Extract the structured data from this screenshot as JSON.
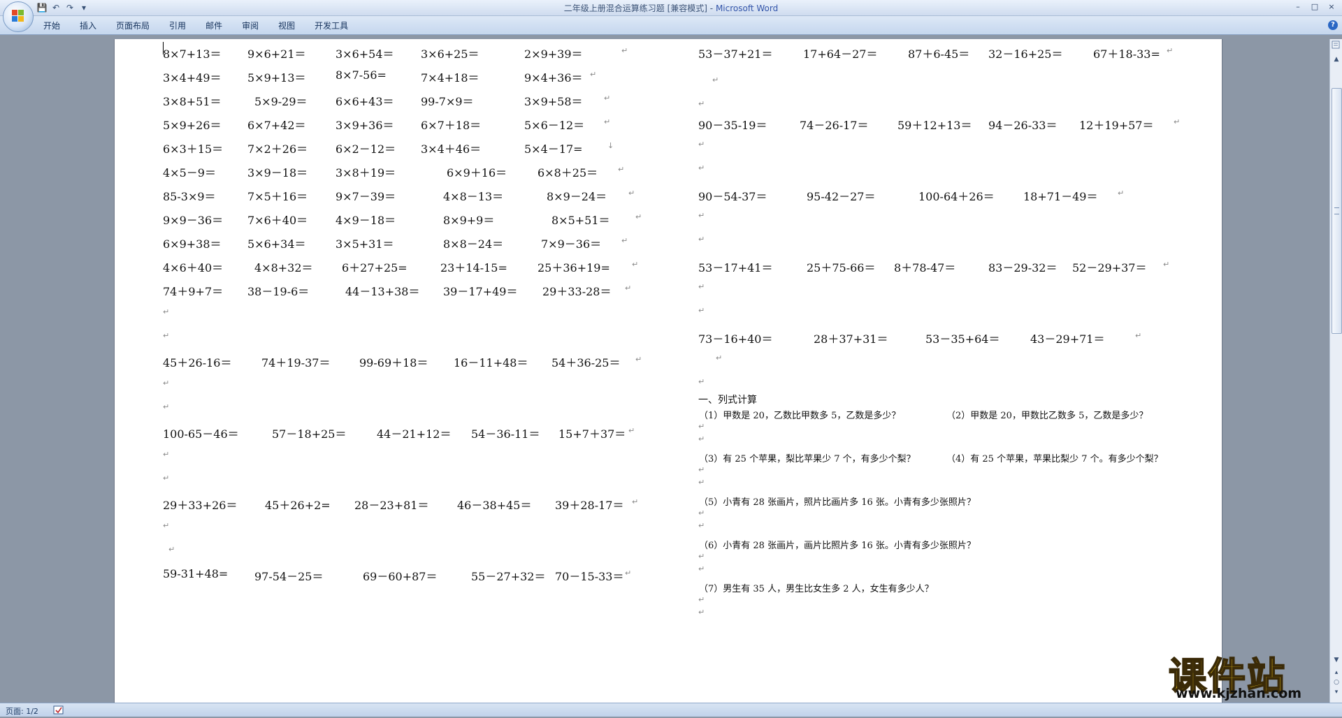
{
  "window": {
    "title": "二年级上册混合运算练习题 [兼容模式]",
    "app_name": "Microsoft Word",
    "title_separator": " - ",
    "controls": [
      "–",
      "□",
      "×"
    ]
  },
  "quick_access": {
    "save_icon": "💾",
    "undo_icon": "↶",
    "redo_icon": "↷",
    "customize_icon": "▾"
  },
  "ribbon": {
    "tabs": [
      "开始",
      "插入",
      "页面布局",
      "引用",
      "邮件",
      "审阅",
      "视图",
      "开发工具"
    ],
    "help_icon": "?"
  },
  "document": {
    "left_column": [
      [
        "8×7+13＝",
        "9×6+21＝",
        "3×6+54＝",
        "3×6+25＝",
        "2×9+39＝"
      ],
      [
        "3×4+49＝",
        "5×9+13＝",
        "8×7-56=",
        "7×4+18＝",
        "9×4+36＝"
      ],
      [
        "3×8+51＝",
        "5×9-29＝",
        "6×6+43＝",
        "99-7×9＝",
        "3×9+58＝"
      ],
      [
        "5×9+26＝",
        "6×7+42＝",
        "3×9+36＝",
        "6×7＋18＝",
        "5×6－12＝"
      ],
      [
        "6×3＋15＝",
        "7×2＋26＝",
        "6×2－12＝",
        "3×4＋46＝",
        "5×4－17="
      ],
      [
        "4×5－9＝",
        "3×9－18＝",
        "3×8＋19＝",
        "6×9＋16＝",
        "6×8＋25＝"
      ],
      [
        "85-3×9＝",
        "7×5＋16＝",
        "9×7－39＝",
        "4×8－13＝",
        "8×9－24＝"
      ],
      [
        "9×9－36＝",
        "7×6＋40＝",
        "4×9－18＝",
        "8×9+9＝",
        "8×5+51＝"
      ],
      [
        "6×9+38＝",
        "5×6+34＝",
        "3×5+31＝",
        "8×8－24＝",
        "7×9－36＝"
      ],
      [
        "4×6＋40＝",
        "4×8+32＝",
        "6＋27+25=",
        "23＋14-15=",
        "25＋36+19="
      ],
      [
        "74＋9+7＝",
        "38－19-6＝",
        "44－13+38＝",
        "39－17+49＝",
        "29＋33-28＝"
      ],
      [
        "45＋26-16＝",
        "74＋19-37＝",
        "99-69＋18＝",
        "16－11+48＝",
        "54＋36-25＝"
      ],
      [
        "100-65－46＝",
        "57－18+25＝",
        "44－21+12＝",
        "54－36-11＝",
        "15+7＋37＝"
      ],
      [
        "29＋33+26＝",
        "45＋26+2=",
        "28－23+81＝",
        "46－38+45＝",
        "39＋28-17＝"
      ],
      [
        "59-31+48=",
        "97-54－25＝",
        "69－60+87＝",
        "55－27+32＝",
        "70－15-33＝"
      ]
    ],
    "right_column": [
      [
        "53－37+21＝",
        "17+64－27＝",
        "87＋6-45＝",
        "32－16+25＝",
        "67＋18-33="
      ],
      [
        "90－35-19＝",
        "74－26-17＝",
        "59＋12+13＝",
        "94－26-33＝",
        "12＋19+57＝"
      ],
      [
        "90－54-37＝",
        "95-42－27＝",
        "100-64＋26＝",
        "18+71－49＝"
      ],
      [
        "53－17+41＝",
        "25＋75-66＝",
        "8＋78-47＝",
        "83－29-32＝",
        "52－29+37＝"
      ],
      [
        "73－16+40＝",
        "28＋37+31＝",
        "53－35+64＝",
        "43－29+71＝"
      ]
    ],
    "section_heading": "一、列式计算",
    "word_problems": [
      "（1）甲数是 20，乙数比甲数多 5，乙数是多少？",
      "（2）甲数是 20，甲数比乙数多 5，乙数是多少？",
      "（3）有 25 个苹果，梨比苹果少 7 个，有多少个梨？",
      "（4）有 25 个苹果，苹果比梨少 7 个。有多少个梨？",
      "（5）小青有 28 张画片，照片比画片多 16 张。小青有多少张照片？",
      "（6）小青有 28 张画片，画片比照片多 16 张。小青有多少张照片？",
      "（7）男生有 35 人，男生比女生多 2 人，女生有多少人？"
    ],
    "paragraph_mark": "↵",
    "line_break_mark": "↓"
  },
  "status_bar": {
    "page_label": "页面: 1/2"
  },
  "watermark": {
    "title": "课件站",
    "url": "www.kjzhan.com"
  }
}
